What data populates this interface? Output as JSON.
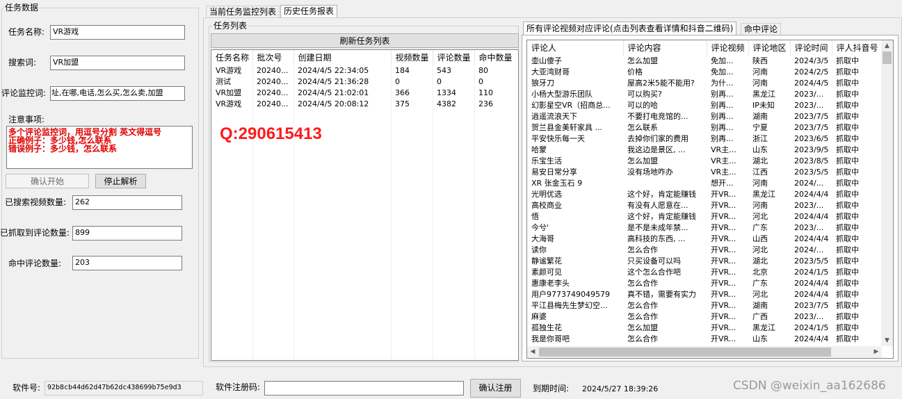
{
  "left_panel": {
    "title": "任务数据",
    "task_name_label": "任务名称:",
    "task_name_value": "VR游戏",
    "search_word_label": "搜索词:",
    "search_word_value": "VR加盟",
    "comment_keywords_label": "评论监控词:",
    "comment_keywords_value": "址,在哪,电话,怎么买,怎么卖,加盟",
    "notes_label": "注意事项:",
    "notes_lines": [
      "多个评论监控词，用逗号分割 英文得逗号",
      "正确例子：多少钱,怎么联系",
      "错误例子：多少钱，怎么联系"
    ],
    "confirm_start": "确认开始",
    "stop_parse": "停止解析",
    "searched_videos_label": "已搜索视频数量:",
    "searched_videos_value": "262",
    "fetched_comments_label": "已抓取到评论数量:",
    "fetched_comments_value": "899",
    "hit_comments_label": "命中评论数量:",
    "hit_comments_value": "203"
  },
  "top_tabs": [
    "当前任务监控列表",
    "历史任务报表"
  ],
  "task_list": {
    "title": "任务列表",
    "refresh_button": "刷新任务列表",
    "columns": [
      "任务名称",
      "批次号",
      "创建日期",
      "视频数量",
      "评论数量",
      "命中数量"
    ],
    "rows": [
      [
        "VR游戏",
        "20240...",
        "2024/4/5 22:34:05",
        "184",
        "543",
        "80"
      ],
      [
        "测试",
        "20240...",
        "2024/4/5 21:36:28",
        "0",
        "0",
        "0"
      ],
      [
        "VR加盟",
        "20240...",
        "2024/4/5 21:02:01",
        "366",
        "1334",
        "110"
      ],
      [
        "VR游戏",
        "20240...",
        "2024/4/5 20:08:12",
        "375",
        "4382",
        "236"
      ]
    ],
    "watermark": "Q:290615413"
  },
  "comment_tabs": [
    "所有评论视频对应评论(点击列表查看详情和抖音二维码)",
    "命中评论"
  ],
  "comment_list": {
    "columns": [
      "评论人",
      "评论内容",
      "评论视频",
      "评论地区",
      "评论时间",
      "评人抖音号"
    ],
    "rows": [
      [
        "壶山傻子",
        "怎么加盟",
        "免加...",
        "陕西",
        "2024/3/5",
        "抓取中"
      ],
      [
        "大亚湾财哥",
        "价格",
        "免加...",
        "河南",
        "2024/2/5",
        "抓取中"
      ],
      [
        "狼牙刀",
        "屋高2米5能不能用?",
        "为什...",
        "河南",
        "2024/4/5",
        "抓取中"
      ],
      [
        "小杨大型游乐团队",
        "可以购买?",
        "别再...",
        "黑龙江",
        "2023/...",
        "抓取中"
      ],
      [
        "幻影星空VR（招商总...",
        "可以的哈",
        "别再...",
        "IP未知",
        "2023/...",
        "抓取中"
      ],
      [
        "逍遥流浪天下",
        "不要打电竞馆的...",
        "别再...",
        "湖南",
        "2023/7/5",
        "抓取中"
      ],
      [
        "贺兰县金美轩家具  ...",
        "怎么联系",
        "别再...",
        "宁夏",
        "2023/7/5",
        "抓取中"
      ],
      [
        "平安快乐每一天",
        "去掉你们家的费用",
        "别再...",
        "浙江",
        "2023/6/5",
        "抓取中"
      ],
      [
        "哈蒙",
        "我这边是景区, ...",
        "VR主...",
        "山东",
        "2023/9/5",
        "抓取中"
      ],
      [
        "乐宝生活",
        "怎么加盟",
        "VR主...",
        "湖北",
        "2023/8/5",
        "抓取中"
      ],
      [
        "易安日常分享",
        "没有场地咋办",
        "VR主...",
        "江西",
        "2023/5/5",
        "抓取中"
      ],
      [
        "XR 张金玉石 9",
        "",
        "想开...",
        "河南",
        "2024/...",
        "抓取中"
      ],
      [
        "光明优选",
        "这个好，肯定能赚钱",
        "开VR...",
        "黑龙江",
        "2024/4/4",
        "抓取中"
      ],
      [
        "高校商业",
        "有没有人愿意在...",
        "开VR...",
        "河南",
        "2023/...",
        "抓取中"
      ],
      [
        "悟",
        "这个好，肯定能赚钱",
        "开VR...",
        "河北",
        "2024/4/4",
        "抓取中"
      ],
      [
        "今兮'",
        "是不是未成年禁...",
        "开VR...",
        "广东",
        "2023/...",
        "抓取中"
      ],
      [
        "大海哥",
        "高科技的东西, ...",
        "开VR...",
        "山西",
        "2024/4/4",
        "抓取中"
      ],
      [
        "读你",
        "怎么合作",
        "开VR...",
        "河北",
        "2024/...",
        "抓取中"
      ],
      [
        "静谧繁花",
        "只买设备可以吗",
        "开VR...",
        "湖北",
        "2023/5/5",
        "抓取中"
      ],
      [
        "素颜可见",
        "这个怎么合作吧",
        "开VR...",
        "北京",
        "2024/1/5",
        "抓取中"
      ],
      [
        "惠康老李头",
        "怎么合作",
        "开VR...",
        "广东",
        "2024/4/4",
        "抓取中"
      ],
      [
        "用户9773749049579",
        "真不错，需要有实力",
        "开VR...",
        "河北",
        "2024/4/4",
        "抓取中"
      ],
      [
        "平江县梅先生梦幻空...",
        "怎么合作",
        "开VR...",
        "湖南",
        "2023/7/5",
        "抓取中"
      ],
      [
        "麻婆",
        "怎么合作",
        "开VR...",
        "广西",
        "2023/...",
        "抓取中"
      ],
      [
        "孤独生花",
        "怎么加盟",
        "开VR...",
        "黑龙江",
        "2024/1/5",
        "抓取中"
      ],
      [
        "我是你哥吧",
        "怎么合作",
        "开VR...",
        "山东",
        "2024/4/4",
        "抓取中"
      ]
    ]
  },
  "footer": {
    "software_id_label": "软件号:",
    "software_id_value": "92b8cb44d62d47b62dc438699b75e9d3",
    "register_label": "软件注册码:",
    "register_value": "",
    "confirm_register": "确认注册",
    "expire_label": "到期时间:",
    "expire_value": "2024/5/27 18:39:26",
    "watermark": "CSDN @weixin_aa162686"
  },
  "colors": {
    "notes_red": "#e00000",
    "window_bg": "#f0f0f0"
  }
}
